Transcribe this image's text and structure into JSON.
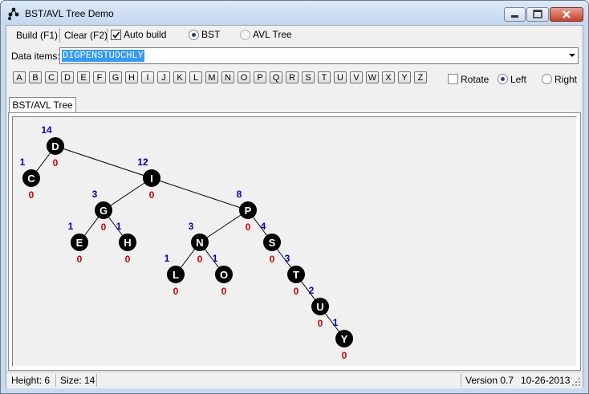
{
  "window": {
    "title": "BST/AVL Tree Demo"
  },
  "toolbar": {
    "build_label": "Build (F1)",
    "clear_label": "Clear (F2)",
    "auto_build_label": "Auto build",
    "auto_build_checked": true,
    "bst_label": "BST",
    "avl_label": "AVL Tree",
    "selected_mode": "BST"
  },
  "data_items": {
    "label": "Data items:",
    "value": "DIGPENSTUOCHLY"
  },
  "letters": [
    "A",
    "B",
    "C",
    "D",
    "E",
    "F",
    "G",
    "H",
    "I",
    "J",
    "K",
    "L",
    "M",
    "N",
    "O",
    "P",
    "Q",
    "R",
    "S",
    "T",
    "U",
    "V",
    "W",
    "X",
    "Y",
    "Z"
  ],
  "options": {
    "rotate_label": "Rotate",
    "rotate_checked": false,
    "left_label": "Left",
    "right_label": "Right",
    "selected_direction": "Left"
  },
  "tab": {
    "label": "BST/AVL Tree"
  },
  "tree": {
    "node_color": "#000000",
    "size_color": "#0000c0",
    "balance_color": "#d00000",
    "nodes": [
      {
        "key": "D",
        "size": "14",
        "balance": "0"
      },
      {
        "key": "C",
        "size": "1",
        "balance": "0"
      },
      {
        "key": "I",
        "size": "12",
        "balance": "0"
      },
      {
        "key": "G",
        "size": "3",
        "balance": "0"
      },
      {
        "key": "P",
        "size": "8",
        "balance": "0"
      },
      {
        "key": "E",
        "size": "1",
        "balance": "0"
      },
      {
        "key": "H",
        "size": "1",
        "balance": "0"
      },
      {
        "key": "N",
        "size": "3",
        "balance": "0"
      },
      {
        "key": "S",
        "size": "4",
        "balance": "0"
      },
      {
        "key": "L",
        "size": "1",
        "balance": "0"
      },
      {
        "key": "O",
        "size": "1",
        "balance": "0"
      },
      {
        "key": "T",
        "size": "3",
        "balance": "0"
      },
      {
        "key": "U",
        "size": "2",
        "balance": "0"
      },
      {
        "key": "Y",
        "size": "1",
        "balance": "0"
      }
    ],
    "edges": [
      [
        "D",
        "C"
      ],
      [
        "D",
        "I"
      ],
      [
        "I",
        "G"
      ],
      [
        "I",
        "P"
      ],
      [
        "G",
        "E"
      ],
      [
        "G",
        "H"
      ],
      [
        "P",
        "N"
      ],
      [
        "P",
        "S"
      ],
      [
        "N",
        "L"
      ],
      [
        "N",
        "O"
      ],
      [
        "S",
        "T"
      ],
      [
        "T",
        "U"
      ],
      [
        "U",
        "Y"
      ]
    ]
  },
  "status": {
    "height": "Height: 6",
    "size": "Size: 14",
    "version": "Version 0.7",
    "date": "10-26-2013"
  }
}
